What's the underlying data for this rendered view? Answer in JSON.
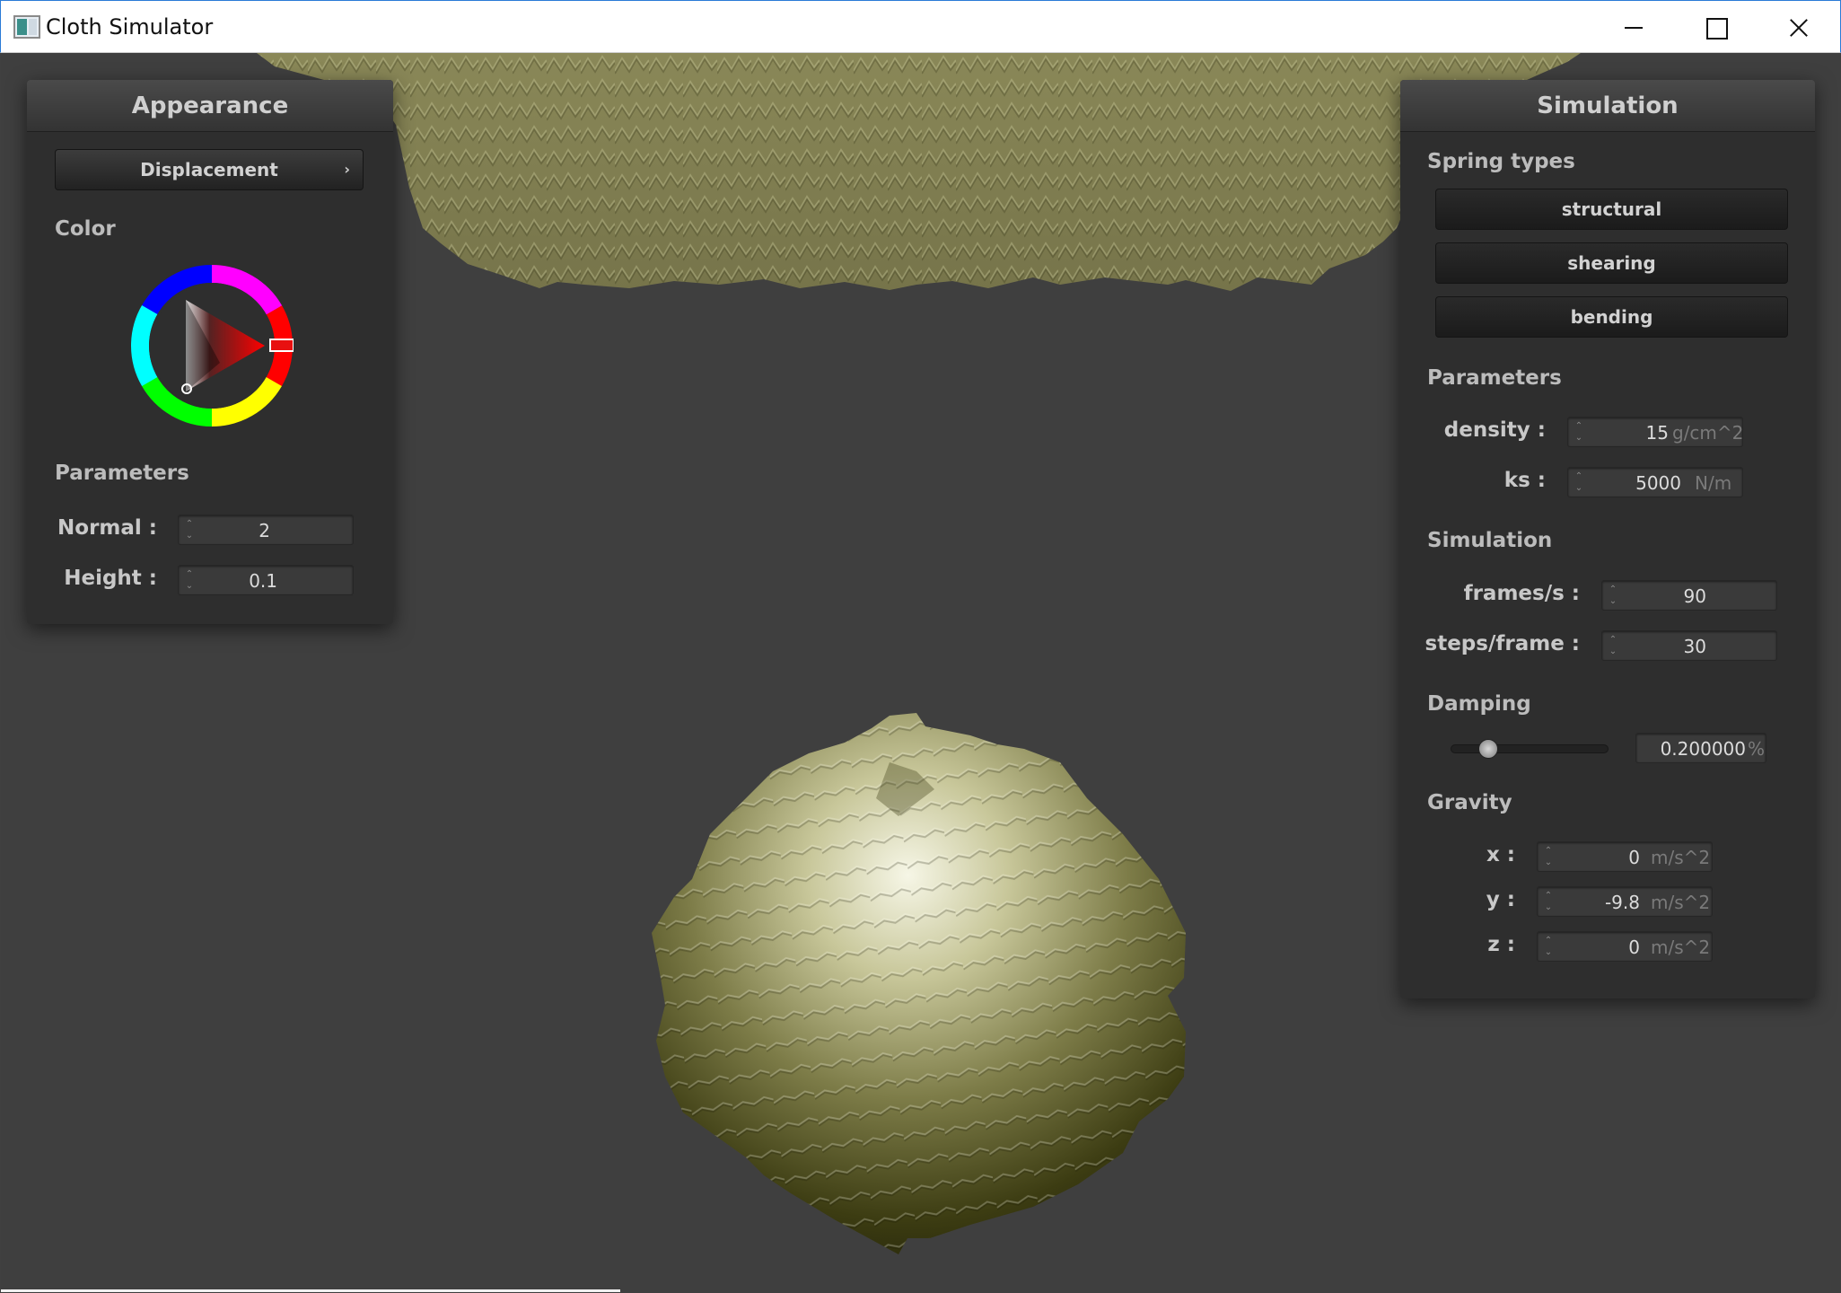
{
  "window": {
    "title": "Cloth Simulator"
  },
  "appearance": {
    "header": "Appearance",
    "shader_select": "Displacement",
    "color_label": "Color",
    "selected_color": "#ff0000",
    "parameters_label": "Parameters",
    "normal_label": "Normal :",
    "normal_value": "2",
    "height_label": "Height :",
    "height_value": "0.1"
  },
  "simulation": {
    "header": "Simulation",
    "spring_types_label": "Spring types",
    "spring_buttons": [
      "structural",
      "shearing",
      "bending"
    ],
    "parameters_label": "Parameters",
    "density_label": "density :",
    "density_value": "15",
    "density_unit": "g/cm^2",
    "ks_label": "ks :",
    "ks_value": "5000",
    "ks_unit": "N/m",
    "simulation_label": "Simulation",
    "fps_label": "frames/s :",
    "fps_value": "90",
    "steps_label": "steps/frame :",
    "steps_value": "30",
    "damping_label": "Damping",
    "damping_value": "0.200000",
    "damping_unit": "%",
    "damping_fraction": 0.2,
    "gravity_label": "Gravity",
    "gx_label": "x :",
    "gx_value": "0",
    "gy_label": "y :",
    "gy_value": "-9.8",
    "gz_label": "z :",
    "gz_value": "0",
    "gravity_unit": "m/s^2"
  },
  "colors": {
    "cloth": "#8c8a5a",
    "sphere_light": "#f4f4e4",
    "sphere_dark": "#2a2a0a",
    "background": "#404040",
    "panel": "#2e2e2e"
  }
}
